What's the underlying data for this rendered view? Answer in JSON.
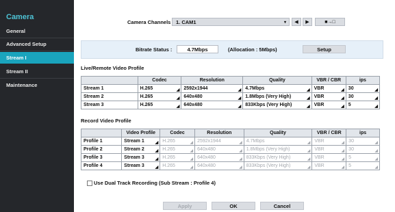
{
  "sidebar": {
    "title": "Camera",
    "items": [
      {
        "label": "General"
      },
      {
        "label": "Advanced Setup"
      },
      {
        "label": "Stream I"
      },
      {
        "label": "Stream II"
      },
      {
        "label": "Maintenance"
      }
    ]
  },
  "channels": {
    "label": "Camera Channels :",
    "value": "1. CAM1",
    "prev_icon": "chevron-left-icon",
    "next_icon": "chevron-right-icon",
    "copy_icon": "copy-settings-icon"
  },
  "bitrate": {
    "label": "Bitrate Status :",
    "value": "4.7Mbps",
    "allocation": "(Allocation : 5Mbps)",
    "setup_label": "Setup"
  },
  "live": {
    "title": "Live/Remote Video Profile",
    "headers": [
      "",
      "Codec",
      "Resolution",
      "Quality",
      "VBR / CBR",
      "ips"
    ],
    "rows": [
      {
        "name": "Stream 1",
        "codec": "H.265",
        "resolution": "2592x1944",
        "quality": "4.7Mbps",
        "vbr": "VBR",
        "ips": "30"
      },
      {
        "name": "Stream 2",
        "codec": "H.265",
        "resolution": "640x480",
        "quality": "1.8Mbps (Very High)",
        "vbr": "VBR",
        "ips": "30"
      },
      {
        "name": "Stream 3",
        "codec": "H.265",
        "resolution": "640x480",
        "quality": "833Kbps (Very High)",
        "vbr": "VBR",
        "ips": "5"
      }
    ]
  },
  "record": {
    "title": "Record Video Profile",
    "headers": [
      "",
      "Video Profile",
      "Codec",
      "Resolution",
      "Quality",
      "VBR / CBR",
      "ips"
    ],
    "rows": [
      {
        "name": "Profile 1",
        "profile": "Stream 1",
        "codec": "H.265",
        "resolution": "2592x1944",
        "quality": "4.7Mbps",
        "vbr": "VBR",
        "ips": "30"
      },
      {
        "name": "Profile 2",
        "profile": "Stream 2",
        "codec": "H.265",
        "resolution": "640x480",
        "quality": "1.8Mbps (Very High)",
        "vbr": "VBR",
        "ips": "30"
      },
      {
        "name": "Profile 3",
        "profile": "Stream 3",
        "codec": "H.265",
        "resolution": "640x480",
        "quality": "833Kbps (Very High)",
        "vbr": "VBR",
        "ips": "5"
      },
      {
        "name": "Profile 4",
        "profile": "Stream 3",
        "codec": "H.265",
        "resolution": "640x480",
        "quality": "833Kbps (Very High)",
        "vbr": "VBR",
        "ips": "5"
      }
    ]
  },
  "dual_track": {
    "label": "Use Dual Track Recording  (Sub Stream : Profile 4)",
    "checked": false
  },
  "footer": {
    "apply": "Apply",
    "ok": "OK",
    "cancel": "Cancel"
  },
  "colors": {
    "sidebar_bg": "#25272b",
    "accent": "#1aa4bd",
    "title_color": "#4ec3d6"
  }
}
